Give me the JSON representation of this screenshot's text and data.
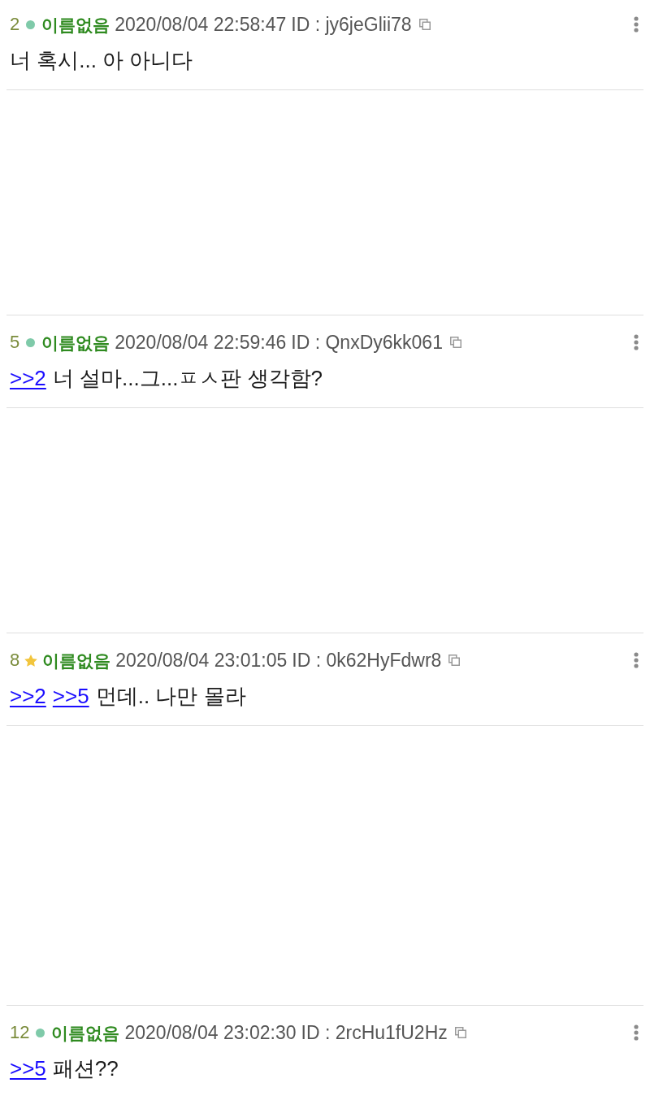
{
  "posts": [
    {
      "number": "2",
      "starred": false,
      "name": "이름없음",
      "timestamp": "2020/08/04 22:58:47",
      "id": "ID : jy6jeGlii78",
      "text": "너 혹시... 아 아니다"
    },
    {
      "number": "5",
      "starred": false,
      "name": "이름없음",
      "timestamp": "2020/08/04 22:59:46",
      "id": "ID : QnxDy6kk061",
      "anchors": [
        ">>2"
      ],
      "text": "너 설마...그...ㅍㅅ판 생각함?"
    },
    {
      "number": "8",
      "starred": true,
      "name": "이름없음",
      "timestamp": "2020/08/04 23:01:05",
      "id": "ID : 0k62HyFdwr8",
      "anchors": [
        ">>2",
        ">>5"
      ],
      "text": "먼데.. 나만 몰라"
    },
    {
      "number": "12",
      "starred": false,
      "name": "이름없음",
      "timestamp": "2020/08/04 23:02:30",
      "id": "ID : 2rcHu1fU2Hz",
      "anchors": [
        ">>5"
      ],
      "text": "패션??"
    }
  ]
}
